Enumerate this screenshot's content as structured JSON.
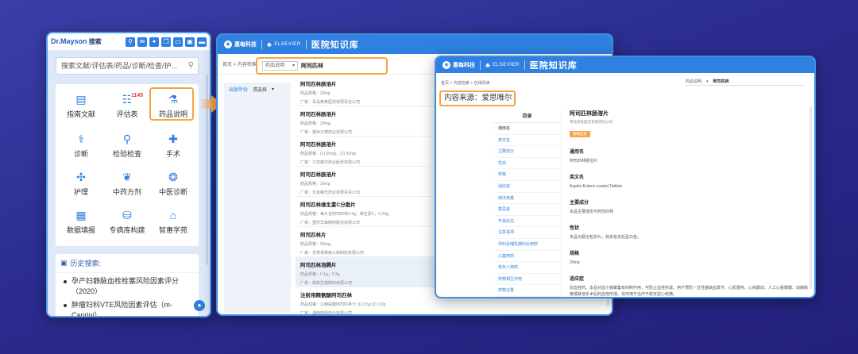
{
  "panel1": {
    "logo": "Dr.Mayson",
    "title": "搜索",
    "search_placeholder": "搜索文献/评估表/药品/诊断/检查/护...",
    "grid": [
      {
        "label": "指南文献",
        "icon": "book-icon",
        "glyph": "▤"
      },
      {
        "label": "评估表",
        "icon": "checklist-icon",
        "glyph": "☷",
        "badge": "1145"
      },
      {
        "label": "药品说明",
        "icon": "medicine-bottle-icon",
        "glyph": "⚗"
      },
      {
        "label": "诊断",
        "icon": "stethoscope-icon",
        "glyph": "⚕"
      },
      {
        "label": "检验检查",
        "icon": "microscope-icon",
        "glyph": "⚲"
      },
      {
        "label": "手术",
        "icon": "surgery-icon",
        "glyph": "✚"
      },
      {
        "label": "护理",
        "icon": "nursing-icon",
        "glyph": "✣"
      },
      {
        "label": "中药方剂",
        "icon": "herbal-icon",
        "glyph": "❦"
      },
      {
        "label": "中医诊断",
        "icon": "tcm-diagnosis-icon",
        "glyph": "❂"
      },
      {
        "label": "数据填报",
        "icon": "data-entry-icon",
        "glyph": "▦"
      },
      {
        "label": "专病库构建",
        "icon": "disease-db-icon",
        "glyph": "⛁"
      },
      {
        "label": "智惠学苑",
        "icon": "academy-icon",
        "glyph": "⌂"
      }
    ],
    "history_title": "历史搜索:",
    "history": [
      "孕产妇静脉血栓栓塞风险因素评分（2020）",
      "肿瘤妇科VTE风险因素评估（m-Caprini）"
    ]
  },
  "panel2": {
    "brand": "惠每科技",
    "elsevier": "ELSEVIER",
    "site_name": "医院知识库",
    "crumb": "首页 > 内容检索",
    "select_label": "药品说明",
    "query": "阿司匹林",
    "filter_label": "出版年份",
    "filter_value": "请选择",
    "results": [
      {
        "title": "阿司匹林肠溶片",
        "spec": "药品规格：20mg",
        "maker": "厂家：青岛某某医药有限责任公司"
      },
      {
        "title": "阿司匹林肠溶片",
        "spec": "药品规格：20mg。",
        "maker": "厂家：德州方德药业有限公司"
      },
      {
        "title": "阿司匹林肠溶片",
        "spec": "药品规格：(1) 25mg；(2) 50mg",
        "maker": "厂家：江苏德华药业股份有限公司"
      },
      {
        "title": "阿司匹林肠溶片",
        "spec": "药品规格：20mg",
        "maker": "厂家：北京曙光药业有限责任公司"
      },
      {
        "title": "阿司匹林维生素C分散片",
        "spec": "药品规格：每片含阿司匹林0.4g，维生素C，0.24g。",
        "maker": "厂家：重庆华森制药股份有限公司"
      },
      {
        "title": "阿司匹林片",
        "spec": "药品规格：50mg。",
        "maker": "厂家：吉林省辉南三和制药有限公司"
      },
      {
        "title": "阿司匹林泡腾片",
        "spec": "药品规格：0.1g；0.3g",
        "maker": "厂家：菲斯生物制药有限公司"
      },
      {
        "title": "注射用精氨酸阿司匹林",
        "spec": "药品规格：以精氨酸阿司匹林计 (1) 0.5g (2) 1.0g",
        "maker": "厂家：湖南衡阳药业有限公司"
      }
    ]
  },
  "panel3": {
    "brand": "惠每科技",
    "elsevier": "ELSEVIER",
    "site_name": "医院知识库",
    "crumb": "首页 > 内容检索 > 在线阅读",
    "select_label": "药品说明",
    "query": "阿司匹林",
    "source": "内容来源：爱思唯尔",
    "toc_title": "目录",
    "toc": [
      "通用名",
      "英文名",
      "主要成分",
      "性状",
      "规格",
      "适应症",
      "用法用量",
      "禁忌症",
      "不良反应",
      "注意事项",
      "孕妇及哺乳期妇女用药",
      "儿童用药",
      "老年人用药",
      "药物相互作用",
      "药物过量"
    ],
    "article_title": "阿司匹林肠溶片",
    "article_maker": "青岛某某医药有限责任公司",
    "article_tag": "精确匹配",
    "sections": [
      {
        "heading": "通用名",
        "body": "阿司匹林肠溶片"
      },
      {
        "heading": "英文名",
        "body": "Aspirin Enteric-coated Tablets"
      },
      {
        "heading": "主要成分",
        "body": "本品主要成份为阿司匹林"
      },
      {
        "heading": "性状",
        "body": "本品为肠溶包衣片，除去包衣后显白色。"
      },
      {
        "heading": "规格",
        "body": "25mg"
      },
      {
        "heading": "适应症",
        "body": "抗血栓药。本品对血小板聚集有抑制作用，可防止血栓形成，用于预防一过性脑缺血发作、心肌梗死、心房颤动、人工心脏瓣膜、动静脉瘘或其他手术后的血栓形成。也可用于治疗不稳定型心绞痛。"
      }
    ]
  }
}
